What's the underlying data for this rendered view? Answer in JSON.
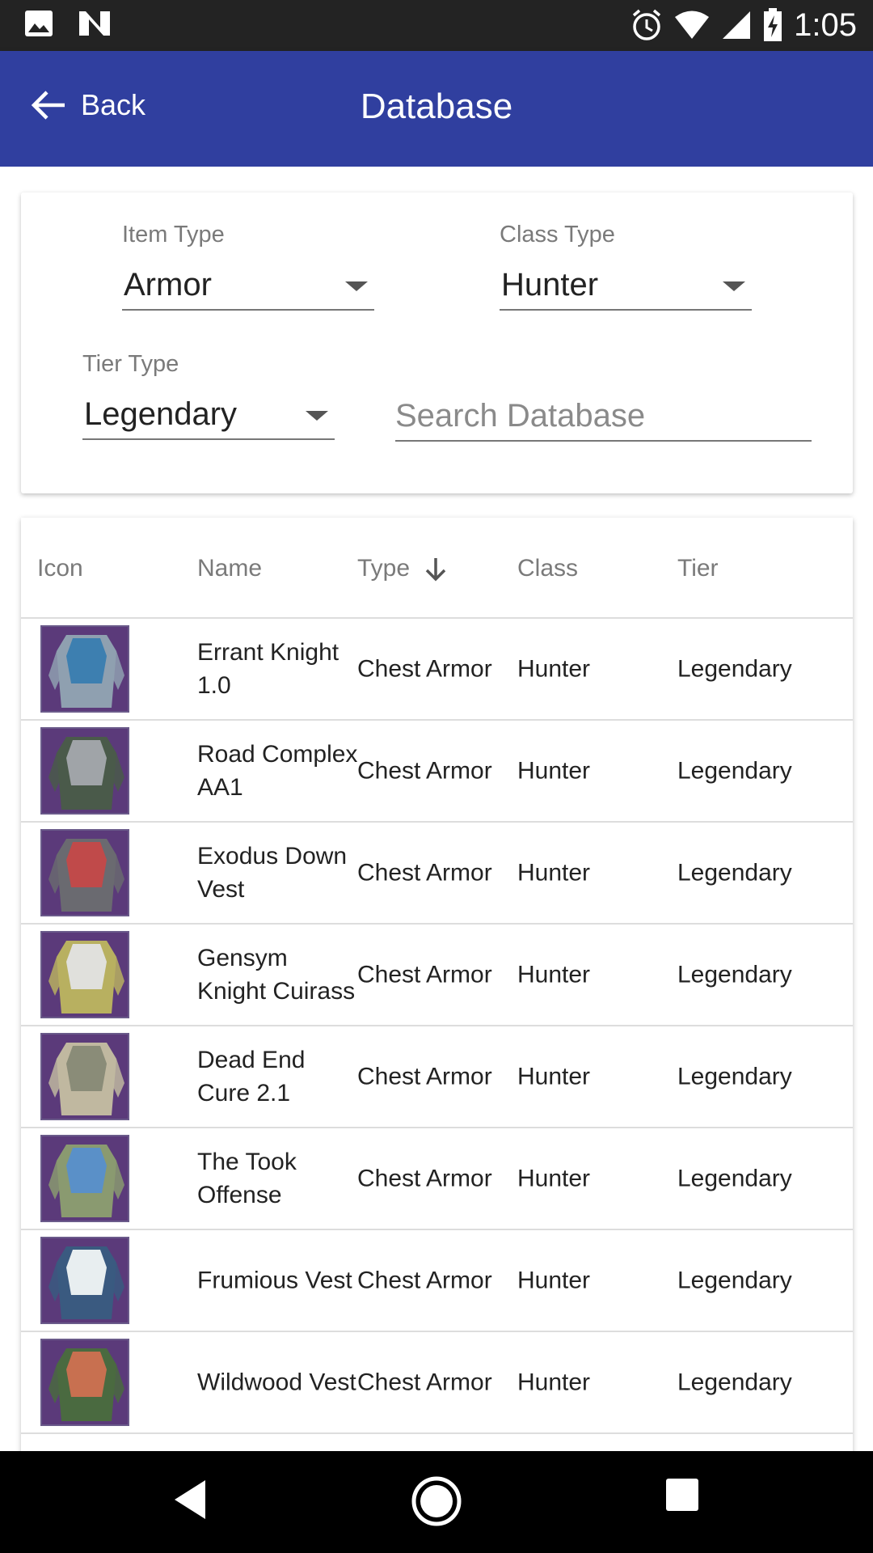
{
  "status_bar": {
    "time": "1:05"
  },
  "app_bar": {
    "back_label": "Back",
    "title": "Database"
  },
  "filters": {
    "item_type": {
      "label": "Item Type",
      "value": "Armor"
    },
    "class_type": {
      "label": "Class Type",
      "value": "Hunter"
    },
    "tier_type": {
      "label": "Tier Type",
      "value": "Legendary"
    },
    "search": {
      "placeholder": "Search Database",
      "value": ""
    }
  },
  "table": {
    "headers": {
      "icon": "Icon",
      "name": "Name",
      "type": "Type",
      "class": "Class",
      "tier": "Tier"
    },
    "rows": [
      {
        "name": "Errant Knight 1.0",
        "type": "Chest Armor",
        "class": "Hunter",
        "tier": "Legendary",
        "colors": [
          "#3d7fb0",
          "#8fa0b0"
        ]
      },
      {
        "name": "Road Complex AA1",
        "type": "Chest Armor",
        "class": "Hunter",
        "tier": "Legendary",
        "colors": [
          "#a0a4a8",
          "#4a5a4a"
        ]
      },
      {
        "name": "Exodus Down Vest",
        "type": "Chest Armor",
        "class": "Hunter",
        "tier": "Legendary",
        "colors": [
          "#c04a4a",
          "#6a6a70"
        ]
      },
      {
        "name": "Gensym Knight Cuirass",
        "type": "Chest Armor",
        "class": "Hunter",
        "tier": "Legendary",
        "colors": [
          "#e0e0dc",
          "#b8b060"
        ]
      },
      {
        "name": "Dead End Cure 2.1",
        "type": "Chest Armor",
        "class": "Hunter",
        "tier": "Legendary",
        "colors": [
          "#8a8c78",
          "#c0b8a0"
        ]
      },
      {
        "name": "The Took Offense",
        "type": "Chest Armor",
        "class": "Hunter",
        "tier": "Legendary",
        "colors": [
          "#5a90c8",
          "#8a9a70"
        ]
      },
      {
        "name": "Frumious Vest",
        "type": "Chest Armor",
        "class": "Hunter",
        "tier": "Legendary",
        "colors": [
          "#e8eef0",
          "#3a5a80"
        ]
      },
      {
        "name": "Wildwood Vest",
        "type": "Chest Armor",
        "class": "Hunter",
        "tier": "Legendary",
        "colors": [
          "#c87050",
          "#4a6a40"
        ]
      }
    ]
  },
  "icons": {
    "status_left": [
      "image-icon",
      "n-logo-icon"
    ],
    "status_right": [
      "alarm-icon",
      "wifi-icon",
      "signal-icon",
      "battery-icon"
    ],
    "nav": [
      "back-triangle-icon",
      "home-circle-icon",
      "recents-square-icon"
    ]
  }
}
